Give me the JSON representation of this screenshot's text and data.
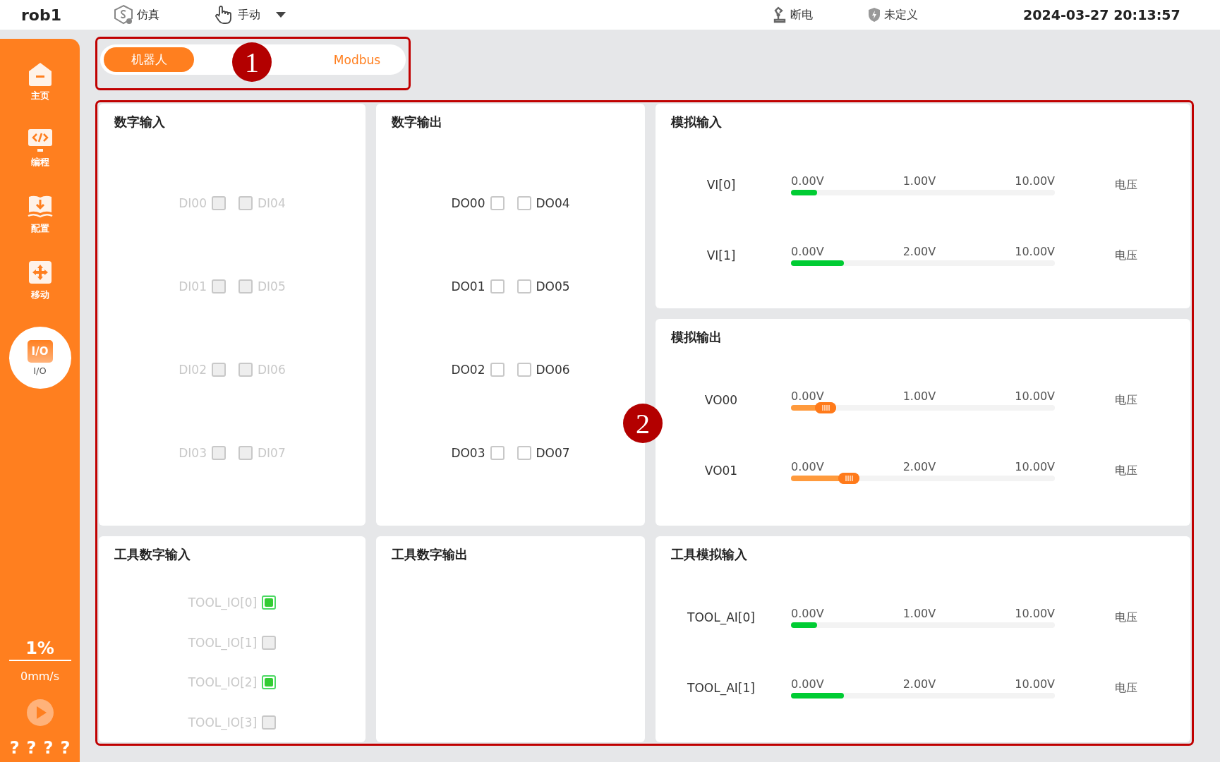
{
  "top_bar": {
    "robot": "rob1",
    "mode": "仿真",
    "control": "手动",
    "power": "断电",
    "safety": "未定义",
    "datetime": "2024-03-27 20:13:57"
  },
  "sidebar": {
    "items": [
      {
        "label": "主页",
        "kind": "home",
        "selected": false
      },
      {
        "label": "编程",
        "kind": "code",
        "selected": false
      },
      {
        "label": "配置",
        "kind": "config",
        "selected": false
      },
      {
        "label": "移动",
        "kind": "move",
        "selected": false
      },
      {
        "label": "I/O",
        "kind": "io",
        "glyph": "I/O",
        "selected": true
      }
    ],
    "speed_percent": "1%",
    "speed": "0mm/s",
    "help": [
      "?",
      "?",
      "?",
      "?"
    ]
  },
  "tabs": [
    {
      "label": "机器人",
      "selected": true
    },
    {
      "label": "Modbus",
      "selected": false
    }
  ],
  "callouts": [
    {
      "label": "1"
    },
    {
      "label": "2"
    }
  ],
  "panels": [
    {
      "kind": "digital",
      "title": "数字输入",
      "disabled": true,
      "rows": [
        {
          "left": {
            "label": "DI00",
            "checked": false
          },
          "right": {
            "label": "DI04",
            "checked": false
          }
        },
        {
          "left": {
            "label": "DI01",
            "checked": false
          },
          "right": {
            "label": "DI05",
            "checked": false
          }
        },
        {
          "left": {
            "label": "DI02",
            "checked": false
          },
          "right": {
            "label": "DI06",
            "checked": false
          }
        },
        {
          "left": {
            "label": "DI03",
            "checked": false
          },
          "right": {
            "label": "DI07",
            "checked": false
          }
        }
      ]
    },
    {
      "kind": "digital",
      "title": "数字输出",
      "disabled": false,
      "rows": [
        {
          "left": {
            "label": "DO00",
            "checked": false
          },
          "right": {
            "label": "DO04",
            "checked": false
          }
        },
        {
          "left": {
            "label": "DO01",
            "checked": false
          },
          "right": {
            "label": "DO05",
            "checked": false
          }
        },
        {
          "left": {
            "label": "DO02",
            "checked": false
          },
          "right": {
            "label": "DO06",
            "checked": false
          }
        },
        {
          "left": {
            "label": "DO03",
            "checked": false
          },
          "right": {
            "label": "DO07",
            "checked": false
          }
        }
      ]
    },
    {
      "kind": "analog_input",
      "title": "模拟输入",
      "channels": [
        {
          "name": "VI[0]",
          "min": "0.00V",
          "value": "1.00V",
          "max": "10.00V",
          "level": 0.1,
          "unit": "电压"
        },
        {
          "name": "VI[1]",
          "min": "0.00V",
          "value": "2.00V",
          "max": "10.00V",
          "level": 0.2,
          "unit": "电压"
        }
      ]
    },
    {
      "kind": "analog_output",
      "title": "模拟输出",
      "channels": [
        {
          "name": "VO00",
          "min": "0.00V",
          "value": "1.00V",
          "max": "10.00V",
          "level": 0.13,
          "unit": "电压"
        },
        {
          "name": "VO01",
          "min": "0.00V",
          "value": "2.00V",
          "max": "10.00V",
          "level": 0.22,
          "unit": "电压"
        }
      ]
    },
    {
      "kind": "tool_digital",
      "title": "工具数字输入",
      "disabled": true,
      "items": [
        {
          "label": "TOOL_IO[0]",
          "checked": true
        },
        {
          "label": "TOOL_IO[1]",
          "checked": false
        },
        {
          "label": "TOOL_IO[2]",
          "checked": true
        },
        {
          "label": "TOOL_IO[3]",
          "checked": false
        }
      ]
    },
    {
      "kind": "empty",
      "title": "工具数字输出"
    },
    {
      "kind": "analog_input",
      "title": "工具模拟输入",
      "channels": [
        {
          "name": "TOOL_AI[0]",
          "min": "0.00V",
          "value": "1.00V",
          "max": "10.00V",
          "level": 0.1,
          "unit": "电压"
        },
        {
          "name": "TOOL_AI[1]",
          "min": "0.00V",
          "value": "2.00V",
          "max": "10.00V",
          "level": 0.2,
          "unit": "电压"
        }
      ]
    }
  ]
}
